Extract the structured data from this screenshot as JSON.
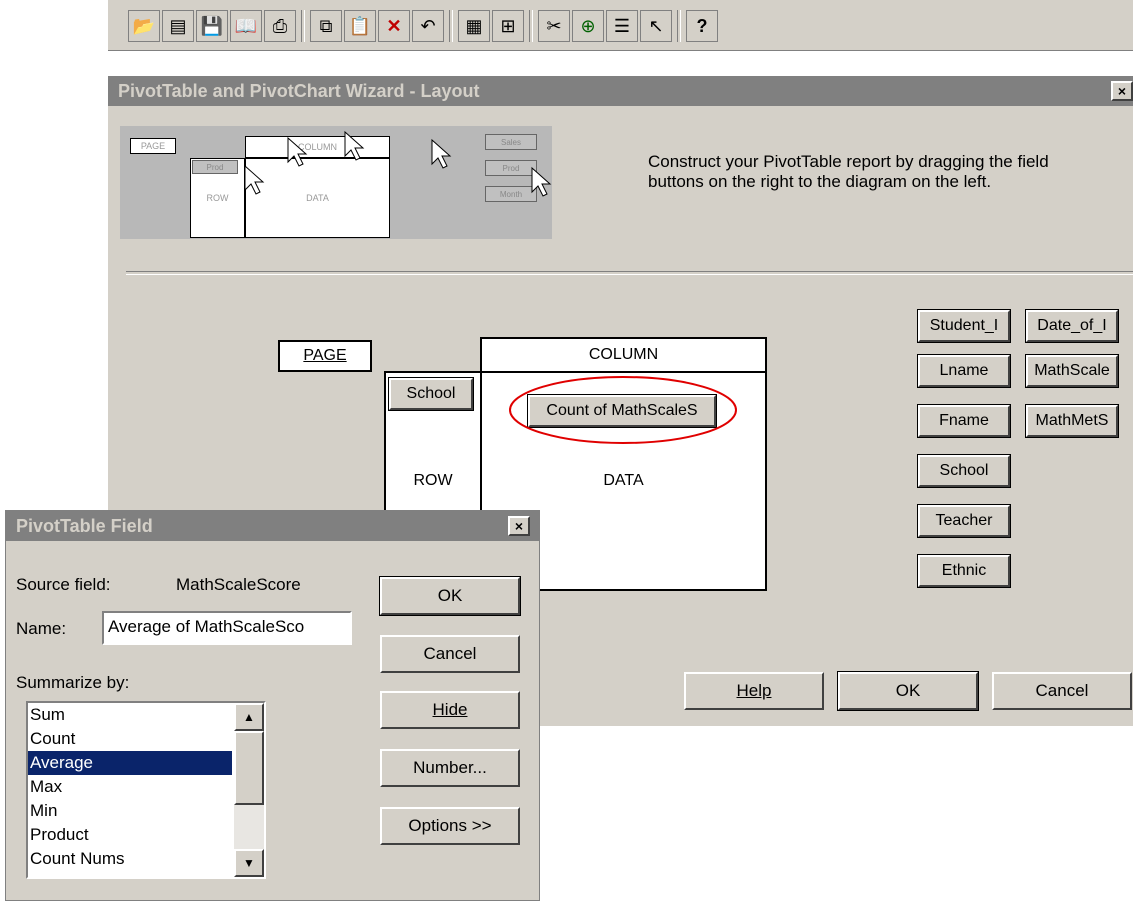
{
  "toolbar": {
    "icons": [
      "open-icon",
      "pivot-icon",
      "save-icon",
      "book-icon",
      "print-icon",
      "copy-icon",
      "paste-icon",
      "delete-icon",
      "undo-icon",
      "chart-icon",
      "add-icon",
      "cut-icon",
      "insert-icon",
      "list-icon",
      "pointer-icon",
      "help-icon"
    ]
  },
  "wizard": {
    "title": "PivotTable and PivotChart Wizard - Layout",
    "close_label": "×",
    "instructions": "Construct your PivotTable report by dragging the field buttons on the right to the diagram on the left.",
    "diagram": {
      "page_label": "PAGE",
      "column_label": "COLUMN",
      "row_label": "ROW",
      "data_label": "DATA",
      "row_field": "School",
      "data_field": "Count of MathScaleS"
    },
    "thumbnail": {
      "page": "PAGE",
      "column": "COLUMN",
      "row": "ROW",
      "data": "DATA",
      "row_field": "Prod",
      "buttons": [
        "Sales",
        "Prod",
        "Month"
      ]
    },
    "fields": [
      "Student_I",
      "Date_of_I",
      "Lname",
      "MathScale",
      "Fname",
      "MathMetS",
      "School",
      "Teacher",
      "Ethnic"
    ],
    "buttons": {
      "help": "Help",
      "ok": "OK",
      "cancel": "Cancel"
    }
  },
  "dialog": {
    "title": "PivotTable Field",
    "close_label": "×",
    "source_field_label": "Source field:",
    "source_field_value": "MathScaleScore",
    "name_label": "Name:",
    "name_value": "Average of MathScaleSco",
    "summarize_label": "Summarize by:",
    "summarize_options": [
      "Sum",
      "Count",
      "Average",
      "Max",
      "Min",
      "Product",
      "Count Nums"
    ],
    "selected_option": "Average",
    "buttons": {
      "ok": "OK",
      "cancel": "Cancel",
      "hide": "Hide",
      "number": "Number...",
      "options": "Options >>"
    }
  },
  "colors": {
    "dialog_face": "#d4d0c8",
    "title_inactive": "#808080",
    "selection": "#0a246a",
    "highlight_circle": "#e00000"
  }
}
